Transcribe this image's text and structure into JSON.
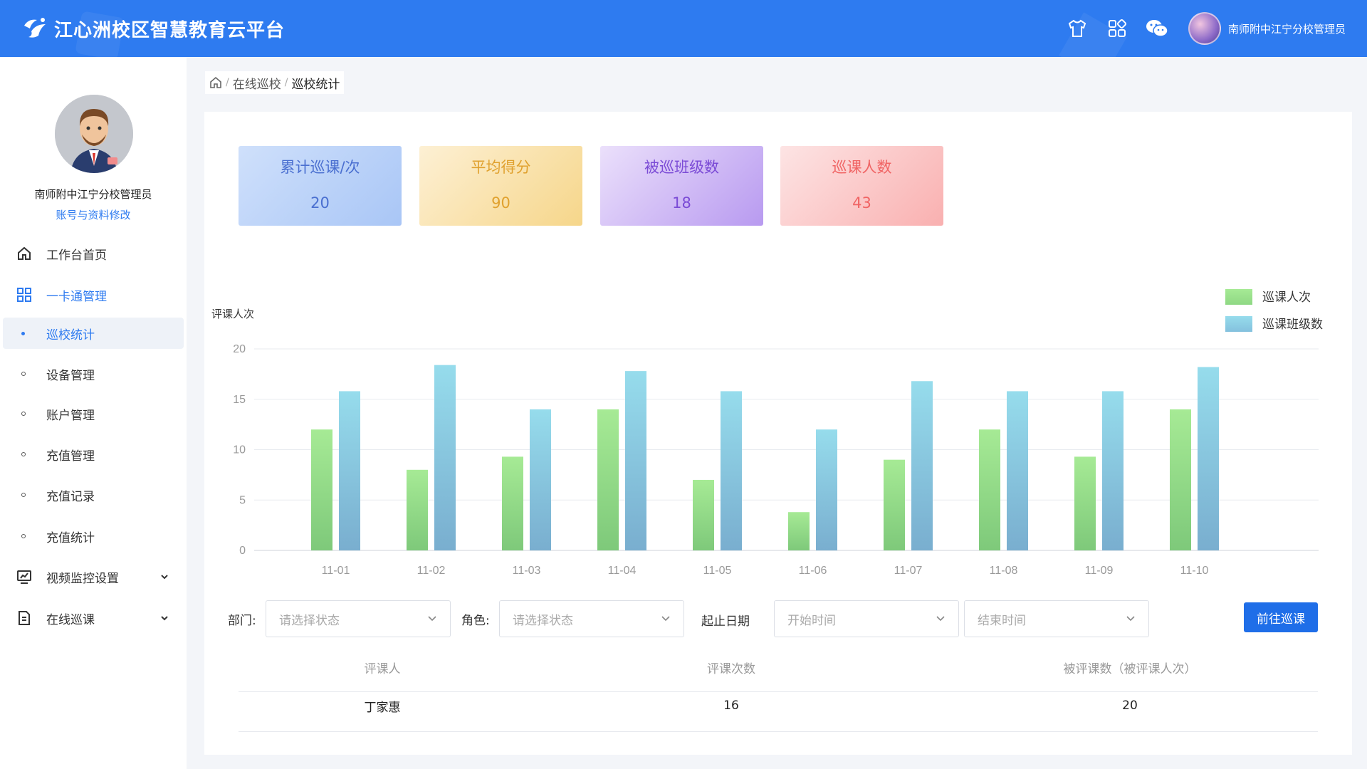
{
  "header": {
    "title": "江心洲校区智慧教育云平台",
    "user": "南师附中江宁分校管理员",
    "icons": [
      "skin-icon",
      "apps-icon",
      "wechat-icon",
      "user-avatar"
    ]
  },
  "sidebar": {
    "profile_name": "南师附中江宁分校管理员",
    "profile_link": "账号与资料修改",
    "items": [
      {
        "label": "工作台首页",
        "icon": "home-icon"
      },
      {
        "label": "一卡通管理",
        "icon": "grid-icon"
      },
      {
        "label": "巡校统计",
        "icon": "dot"
      },
      {
        "label": "设备管理",
        "icon": "dot"
      },
      {
        "label": "账户管理",
        "icon": "dot"
      },
      {
        "label": "充值管理",
        "icon": "dot"
      },
      {
        "label": "充值记录",
        "icon": "dot"
      },
      {
        "label": "充值统计",
        "icon": "dot"
      },
      {
        "label": "视频监控设置",
        "icon": "monitor-icon"
      },
      {
        "label": "在线巡课",
        "icon": "document-icon"
      }
    ]
  },
  "breadcrumb": {
    "items": [
      "在线巡校",
      "巡校统计"
    ]
  },
  "stats": [
    {
      "label": "累计巡课/次",
      "value": "20",
      "color": "#4a6fd0"
    },
    {
      "label": "平均得分",
      "value": "90",
      "color": "#e0a12e"
    },
    {
      "label": "被巡班级数",
      "value": "18",
      "color": "#7b4bd6"
    },
    {
      "label": "巡课人数",
      "value": "43",
      "color": "#f06464"
    }
  ],
  "chart_data": {
    "type": "bar",
    "ylabel": "评课人次",
    "ylim": [
      0,
      20
    ],
    "yticks": [
      0,
      5,
      10,
      15,
      20
    ],
    "categories": [
      "11-01",
      "11-02",
      "11-03",
      "11-04",
      "11-05",
      "11-06",
      "11-07",
      "11-08",
      "11-09",
      "11-10"
    ],
    "series": [
      {
        "name": "巡课人次",
        "values": [
          12,
          8,
          9.3,
          14,
          7,
          3.8,
          9,
          12,
          9.3,
          14
        ],
        "color": "#9bdf8a"
      },
      {
        "name": "巡课班级数",
        "values": [
          15.8,
          18.4,
          14,
          17.8,
          15.8,
          12,
          16.8,
          15.8,
          15.8,
          18.2
        ],
        "color": "#8fd3e8"
      }
    ],
    "legend": "top-right",
    "grid": true
  },
  "filters": {
    "dept_label": "部门:",
    "dept_placeholder": "请选择状态",
    "role_label": "角色:",
    "role_placeholder": "请选择状态",
    "date_label": "起止日期",
    "start_placeholder": "开始时间",
    "end_placeholder": "结束时间",
    "go_button": "前往巡课"
  },
  "table": {
    "headers": [
      "评课人",
      "评课次数",
      "被评课数（被评课人次）"
    ],
    "rows": [
      [
        "丁家惠",
        "16",
        "20"
      ]
    ]
  }
}
